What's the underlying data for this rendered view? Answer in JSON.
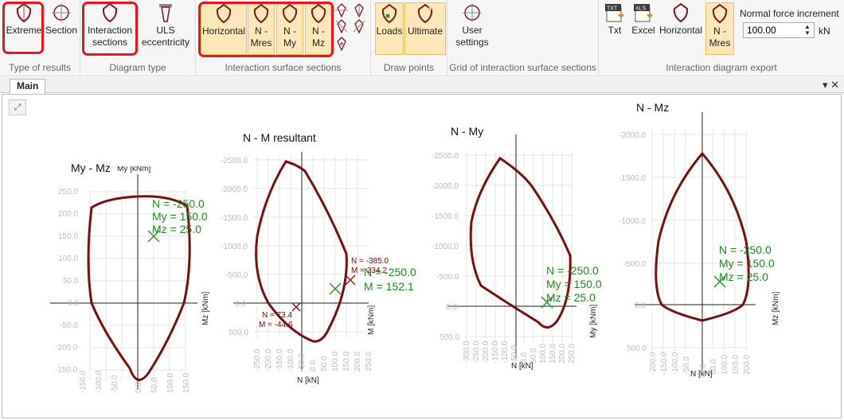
{
  "ribbon": {
    "groups": {
      "type_of_results": "Type of results",
      "diagram_type": "Diagram type",
      "sections": "Interaction surface sections",
      "draw_points": "Draw points",
      "grid": "Grid of interaction surface sections",
      "export": "Interaction diagram export"
    },
    "buttons": {
      "extreme": "Extreme",
      "section": "Section",
      "interaction": "Interaction",
      "sections": "sections",
      "uls": "ULS",
      "eccentricity": "eccentricity",
      "horizontal": "Horizontal",
      "nmres1": "N -",
      "nmres2": "Mres",
      "nmy1": "N -",
      "nmy2": "My",
      "nmz1": "N -",
      "nmz2": "Mz",
      "loads": "Loads",
      "ultimate": "Ultimate",
      "user": "User",
      "settings": "settings",
      "txt": "Txt",
      "excel": "Excel",
      "exp_horizontal": "Horizontal",
      "exp_nmres1": "N -",
      "exp_nmres2": "Mres",
      "txt_badge": "TXT",
      "xls_badge": "XLS"
    },
    "normal_force": {
      "label": "Normal force increment",
      "value": "100.00",
      "unit": "kN"
    }
  },
  "tabs": {
    "main": "Main",
    "controls": "▾ ✕"
  },
  "charts": [
    {
      "title": "My - Mz",
      "ylab": "My [kNm]",
      "xlab": "Mz [kNm]",
      "yticks": [
        "250.0",
        "200.0",
        "150.0",
        "100.0",
        "50.0",
        "0.0",
        "-50.0",
        "-100.0",
        "-150.0"
      ],
      "xticks": [
        "-150.0",
        "-100.0",
        "-50.0",
        "0.0",
        "50.0",
        "100.0",
        "150.0"
      ],
      "labels": [
        "N = -250.0",
        "My = 150.0",
        "Mz = 25.0"
      ]
    },
    {
      "title": "N - M resultant",
      "ylab": "M [kNm]",
      "xlab": "N [kN]",
      "yticks": [
        "-2500.0",
        "-2000.0",
        "-1500.0",
        "-1000.0",
        "-500.0",
        "0.0",
        "500.0"
      ],
      "xticks": [
        "-250.0",
        "-200.0",
        "-150.0",
        "-100.0",
        "-50.0",
        "0.0",
        "50.0",
        "100.0",
        "150.0",
        "200.0",
        "250.0"
      ],
      "labels": [
        "N = -250.0",
        "M = 152.1"
      ],
      "pt1": [
        "N = -385.0",
        "M = 234.2"
      ],
      "pt2": [
        "N = 73.4",
        "M = -44.6"
      ]
    },
    {
      "title": "N - My",
      "ylab": "My [kNm]",
      "xlab": "N [kN]",
      "yticks": [
        "-2500.0",
        "-2000.0",
        "-1500.0",
        "-1000.0",
        "-500.0",
        "0.0",
        "500.0"
      ],
      "xticks": [
        "-300.0",
        "-250.0",
        "-200.0",
        "-150.0",
        "-100.0",
        "-50.0",
        "0.0",
        "50.0",
        "100.0",
        "150.0",
        "200.0",
        "250.0"
      ],
      "labels": [
        "N = -250.0",
        "My = 150.0",
        "Mz = 25.0"
      ]
    },
    {
      "title": "N - Mz",
      "ylab": "Mz [kNm]",
      "xlab": "N [kN]",
      "yticks": [
        "-2000.0",
        "-1500.0",
        "-1000.0",
        "-500.0",
        "0.0",
        "500.0"
      ],
      "xticks": [
        "-200.0",
        "-150.0",
        "-100.0",
        "-50.0",
        "0.0",
        "50.0",
        "100.0",
        "150.0",
        "200.0"
      ],
      "labels": [
        "N = -250.0",
        "My = 150.0",
        "Mz = 25.0"
      ]
    }
  ],
  "colors": {
    "curve": "#7a0f0f",
    "marker": "#2e9a2e",
    "accent": "#e8141e"
  }
}
